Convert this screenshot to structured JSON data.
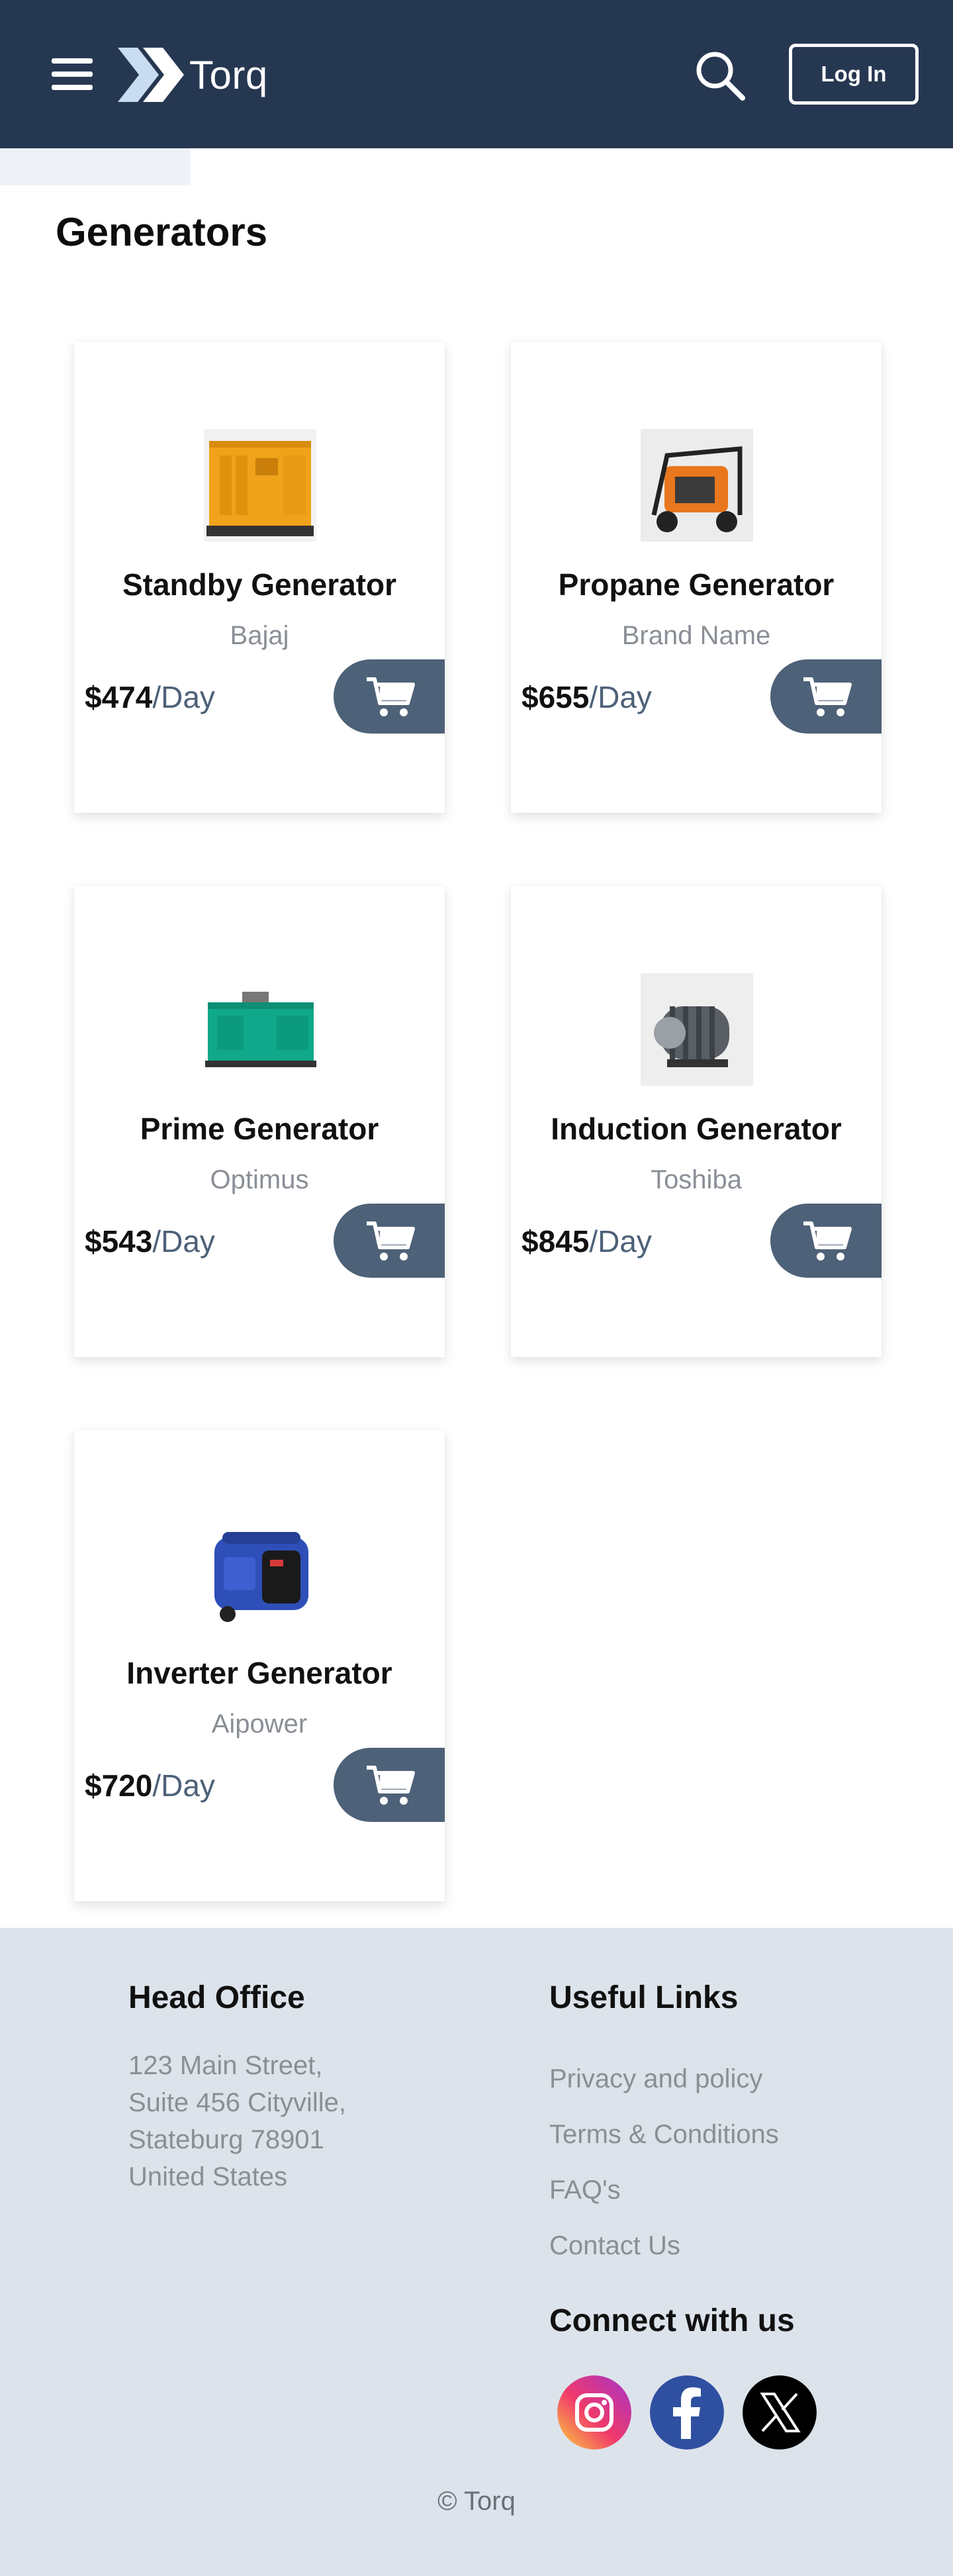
{
  "header": {
    "logo_text": "Torq",
    "login_label": "Log In"
  },
  "page": {
    "title": "Generators"
  },
  "products": [
    {
      "name": "Standby Generator",
      "brand": "Bajaj",
      "price": "$474",
      "unit": "/Day"
    },
    {
      "name": "Propane Generator",
      "brand": "Brand Name",
      "price": "$655",
      "unit": "/Day"
    },
    {
      "name": "Prime Generator",
      "brand": "Optimus",
      "price": "$543",
      "unit": "/Day"
    },
    {
      "name": "Induction Generator",
      "brand": "Toshiba",
      "price": "$845",
      "unit": "/Day"
    },
    {
      "name": "Inverter Generator",
      "brand": "Aipower",
      "price": "$720",
      "unit": "/Day"
    }
  ],
  "footer": {
    "head_office_title": "Head Office",
    "address": [
      "123 Main Street,",
      "Suite 456 Cityville,",
      "Stateburg 78901",
      "United States"
    ],
    "links_title": "Useful Links",
    "links": [
      "Privacy and policy",
      "Terms & Conditions",
      "FAQ's",
      "Contact Us"
    ],
    "connect_title": "Connect with us",
    "social": [
      "instagram-icon",
      "facebook-icon",
      "x-icon"
    ],
    "copyright": "© Torq"
  },
  "colors": {
    "header_bg": "#263751",
    "accent": "#4d6178",
    "footer_bg": "#dde3eb"
  }
}
